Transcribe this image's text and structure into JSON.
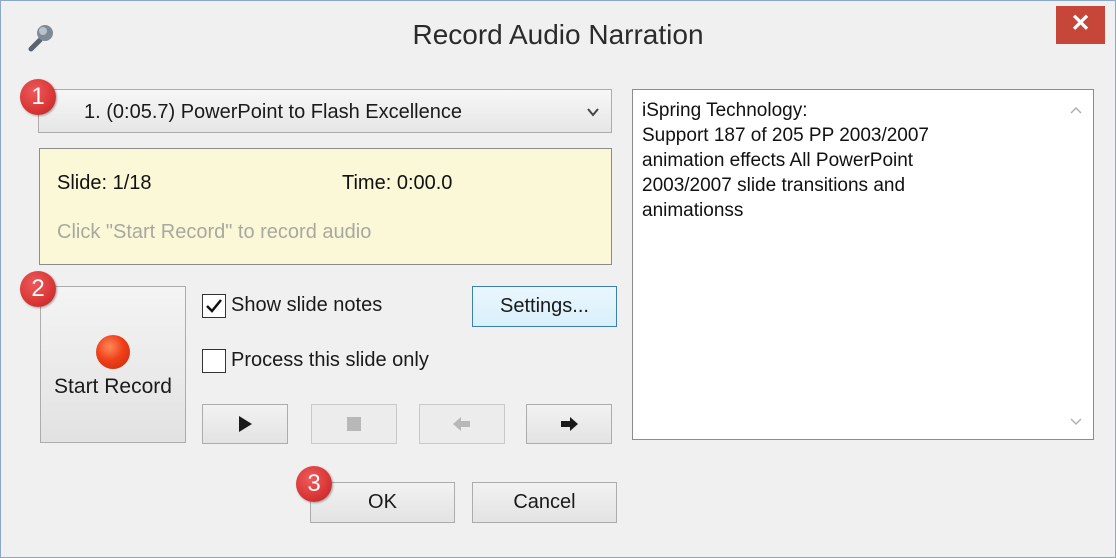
{
  "window": {
    "title": "Record Audio Narration",
    "close_glyph": "✕",
    "icon": "microphone-icon"
  },
  "slide_dropdown": {
    "selected": "1. (0:05.7) PowerPoint to Flash Excellence"
  },
  "info": {
    "slide": "Slide: 1/18",
    "time": "Time: 0:00.0",
    "hint": "Click \"Start Record\" to record audio"
  },
  "record": {
    "label": "Start Record",
    "dot_color": "#f0401a"
  },
  "options": {
    "show_notes_label": "Show slide notes",
    "show_notes_checked": true,
    "process_slide_label": "Process this slide only",
    "process_slide_checked": false
  },
  "buttons": {
    "settings": "Settings...",
    "ok": "OK",
    "cancel": "Cancel"
  },
  "media_controls": [
    {
      "icon": "play-icon",
      "enabled": true
    },
    {
      "icon": "stop-icon",
      "enabled": false
    },
    {
      "icon": "arrow-left-icon",
      "enabled": false
    },
    {
      "icon": "arrow-right-icon",
      "enabled": true
    }
  ],
  "notes": {
    "lines": [
      "iSpring Technology:",
      "Support 187 of 205 PP 2003/2007",
      "animation effects All PowerPoint",
      "2003/2007 slide transitions and",
      "animationss"
    ]
  },
  "badges": [
    "1",
    "2",
    "3"
  ],
  "colors": {
    "badge": "#d93636",
    "close": "#c7463a",
    "info_bg": "#fbf8d8",
    "settings_border": "#3c7fb1"
  }
}
